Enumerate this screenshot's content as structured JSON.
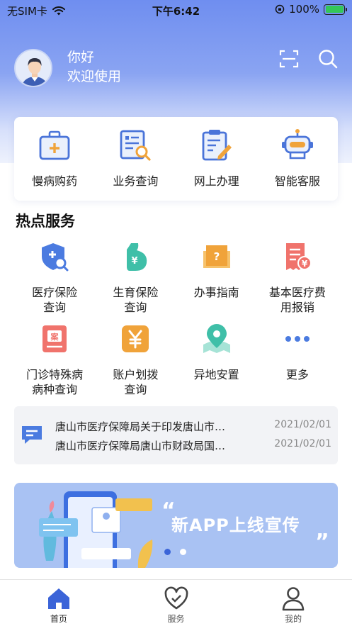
{
  "status_bar": {
    "carrier": "无SIM卡",
    "time": "下午6:42",
    "battery": "100%"
  },
  "header": {
    "greeting": "你好",
    "welcome": "欢迎使用"
  },
  "quick_actions": [
    {
      "label": "慢病购药",
      "icon": "medical-kit-icon"
    },
    {
      "label": "业务查询",
      "icon": "document-search-icon"
    },
    {
      "label": "网上办理",
      "icon": "clipboard-edit-icon"
    },
    {
      "label": "智能客服",
      "icon": "robot-icon"
    }
  ],
  "hot_services": {
    "title": "热点服务",
    "items": [
      {
        "line1": "医疗保险",
        "line2": "查询",
        "icon": "shield-plus-search-icon"
      },
      {
        "line1": "生育保险",
        "line2": "查询",
        "icon": "pregnancy-yuan-icon"
      },
      {
        "line1": "办事指南",
        "line2": "",
        "icon": "guide-book-icon"
      },
      {
        "line1": "基本医疗费",
        "line2": "用报销",
        "icon": "receipt-yuan-icon"
      },
      {
        "line1": "门诊特殊病",
        "line2": "病种查询",
        "icon": "case-file-icon"
      },
      {
        "line1": "账户划拨",
        "line2": "查询",
        "icon": "yuan-account-icon"
      },
      {
        "line1": "异地安置",
        "line2": "",
        "icon": "location-map-icon"
      },
      {
        "line1": "更多",
        "line2": "",
        "icon": "more-dots-icon"
      }
    ]
  },
  "news": [
    {
      "title": "唐山市医疗保障局关于印发唐山市…",
      "date": "2021/02/01"
    },
    {
      "title": "唐山市医疗保障局唐山市财政局国…",
      "date": "2021/02/01"
    }
  ],
  "banner": {
    "text": "新APP上线宣传"
  },
  "tabbar": [
    {
      "label": "首页",
      "icon": "home-icon",
      "active": true
    },
    {
      "label": "服务",
      "icon": "heart-icon",
      "active": false
    },
    {
      "label": "我的",
      "icon": "user-icon",
      "active": false
    }
  ],
  "colors": {
    "primary": "#3b64d8",
    "header_top": "#6f8ef0",
    "banner": "#a9c2f3"
  }
}
